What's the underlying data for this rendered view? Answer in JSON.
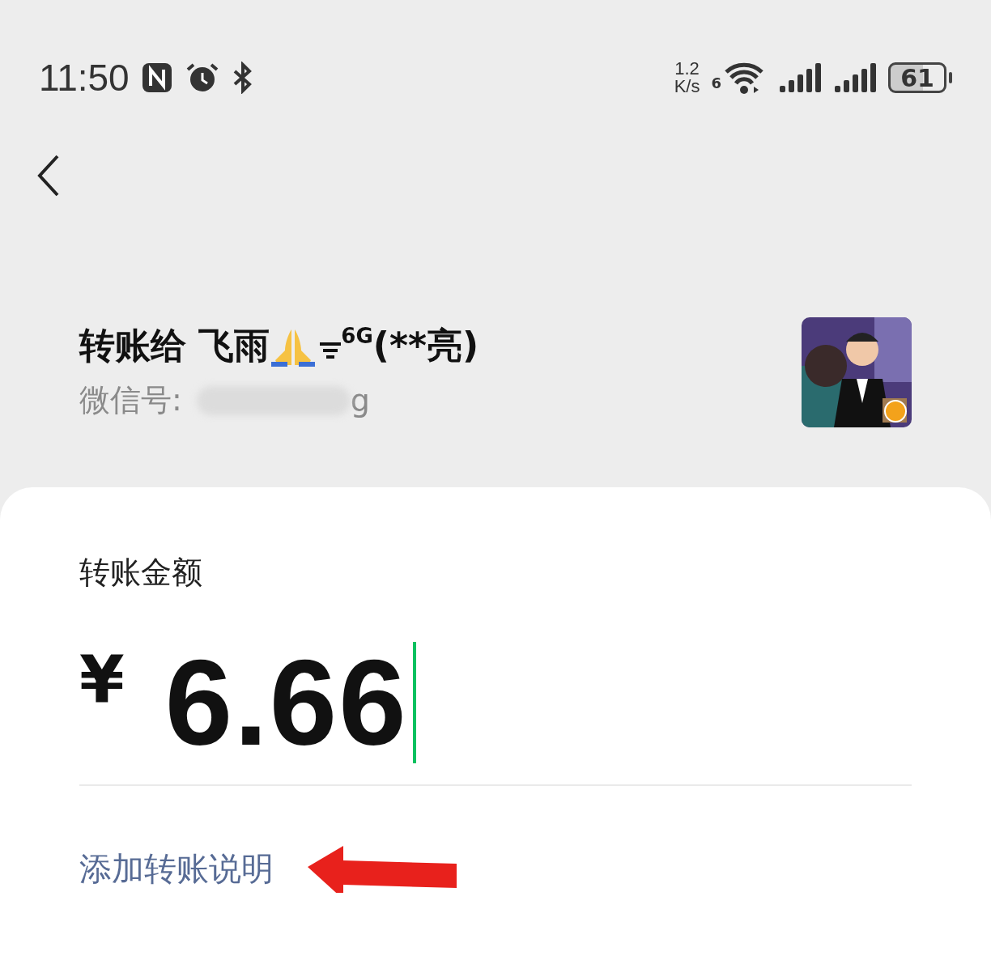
{
  "status_bar": {
    "time": "11:50",
    "speed_value": "1.2",
    "speed_unit": "K/s",
    "wifi_badge": "6",
    "battery": "61"
  },
  "recipient": {
    "title_prefix": "转账给 飞雨",
    "title_suffix": "$^{6G}$(**亮)",
    "id_label": "微信号:",
    "id_visible": "g",
    "verified": true
  },
  "amount": {
    "label": "转账金额",
    "currency": "¥",
    "value": "6.66"
  },
  "note_link": "添加转账说明"
}
